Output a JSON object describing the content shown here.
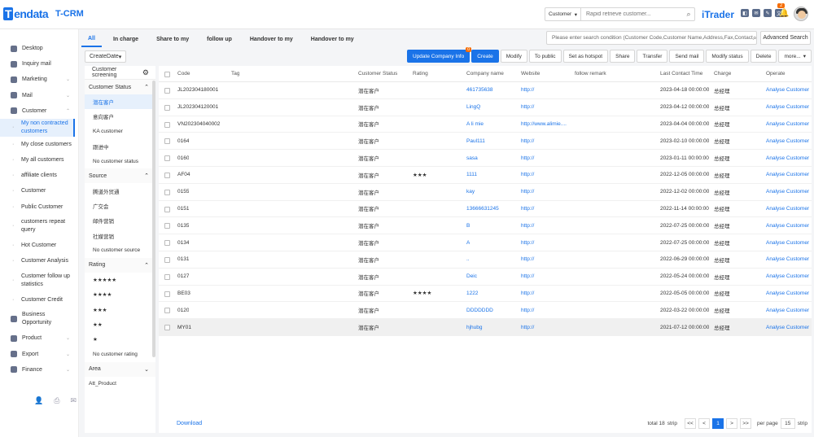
{
  "brand": {
    "logo": "Tendata",
    "logo_initial": "T",
    "product": "T-CRM",
    "itrader": "iTrader"
  },
  "topbar": {
    "search_select": "Customer",
    "search_placeholder": "Rapid retrieve customer...",
    "bell_badge": "2",
    "icons": [
      "app-icon",
      "mail-icon",
      "edit-icon",
      "translate-icon"
    ]
  },
  "sidebar": {
    "items": [
      {
        "label": "Desktop",
        "icon": "desktop-icon"
      },
      {
        "label": "Inquiry mail",
        "icon": "inquiry-icon"
      },
      {
        "label": "Marketing",
        "icon": "marketing-icon",
        "arrow": "⌄"
      },
      {
        "label": "Mail",
        "icon": "mail-icon",
        "arrow": "⌄"
      },
      {
        "label": "Customer",
        "icon": "customer-icon",
        "arrow": "⌃"
      }
    ],
    "sub_items": [
      {
        "label": "My non contracted customers",
        "active": true
      },
      {
        "label": "My close customers"
      },
      {
        "label": "My all customers"
      },
      {
        "label": "affiliate clients"
      },
      {
        "label": "Customer"
      },
      {
        "label": "Public Customer"
      },
      {
        "label": "customers repeat query"
      },
      {
        "label": "Hot Customer"
      },
      {
        "label": "Customer Analysis"
      },
      {
        "label": "Customer follow up statistics"
      },
      {
        "label": "Customer Credit"
      }
    ],
    "bottom_items": [
      {
        "label": "Business Opportunity",
        "icon": "business-icon"
      },
      {
        "label": "Product",
        "icon": "product-icon",
        "arrow": "⌄"
      },
      {
        "label": "Export",
        "icon": "export-icon",
        "arrow": "⌄"
      },
      {
        "label": "Finance",
        "icon": "finance-icon",
        "arrow": "⌄"
      }
    ]
  },
  "tabs": [
    "All",
    "In charge",
    "Share to my",
    "follow up",
    "Handover to my",
    "Handover to my"
  ],
  "condition_search_placeholder": "Please enter search condition (Customer Code,Customer Name,Address,Fax,Contact",
  "advanced_search": "Advanced Search",
  "sort_select": "CreateDate",
  "toolbar": {
    "update_label": "Update Company Info",
    "update_badge": "0",
    "buttons": [
      "Create",
      "Modify",
      "To public",
      "Set as hotspot",
      "Share",
      "Transfer",
      "Send mail",
      "Modify status",
      "Delete",
      "more..."
    ]
  },
  "filter": {
    "title": "Customer screening",
    "sections": [
      {
        "title": "Customer Status",
        "arrow": "⌃",
        "options": [
          "潜在客户",
          "意向客户",
          "KA customer",
          "跟进中",
          "No customer status"
        ],
        "active_index": 0
      },
      {
        "title": "Source",
        "arrow": "⌃",
        "options": [
          "腾道外贸通",
          "广交会",
          "邮件营销",
          "社媒营销",
          "No customer source"
        ]
      },
      {
        "title": "Rating",
        "arrow": "⌃",
        "options": [
          "★★★★★",
          "★★★★",
          "★★★",
          "★★",
          "★",
          "No customer rating"
        ]
      },
      {
        "title": "Area",
        "arrow": "⌄",
        "options": [
          "Att_Product"
        ]
      }
    ]
  },
  "table": {
    "headers": [
      "Code",
      "Tag",
      "Customer Status",
      "Rating",
      "Company name",
      "Website",
      "follow remark",
      "Last Contact Time",
      "Charge",
      "Operate"
    ],
    "rows": [
      {
        "code": "JL202304180001",
        "status": "潜在客户",
        "rating": "",
        "company": "461735638",
        "website": "http://",
        "last": "2023-04-18 00:00:00",
        "charge": "总经理",
        "op": "Analyse Customer"
      },
      {
        "code": "JL202304120001",
        "status": "潜在客户",
        "rating": "",
        "company": "LingQ",
        "website": "http://",
        "last": "2023-04-12 00:00:00",
        "charge": "总经理",
        "op": "Analyse Customer"
      },
      {
        "code": "VN202304040002",
        "status": "潜在客户",
        "rating": "",
        "company": "A li mie",
        "website": "http://www.alimie....",
        "last": "2023-04-04 00:00:00",
        "charge": "总经理",
        "op": "Analyse Customer"
      },
      {
        "code": "0164",
        "status": "潜在客户",
        "rating": "",
        "company": "Paul111",
        "website": "http://",
        "last": "2023-02-10 00:00:00",
        "charge": "总经理",
        "op": "Analyse Customer"
      },
      {
        "code": "0160",
        "status": "潜在客户",
        "rating": "",
        "company": "sasa",
        "website": "http://",
        "last": "2023-01-11 00:00:00",
        "charge": "总经理",
        "op": "Analyse Customer"
      },
      {
        "code": "AF04",
        "status": "潜在客户",
        "rating": "★★★",
        "company": "1111",
        "website": "http://",
        "last": "2022-12-05 00:00:00",
        "charge": "总经理",
        "op": "Analyse Customer"
      },
      {
        "code": "0155",
        "status": "潜在客户",
        "rating": "",
        "company": "kay",
        "website": "http://",
        "last": "2022-12-02 00:00:00",
        "charge": "总经理",
        "op": "Analyse Customer"
      },
      {
        "code": "0151",
        "status": "潜在客户",
        "rating": "",
        "company": "13666631245",
        "website": "http://",
        "last": "2022-11-14 00:00:00",
        "charge": "总经理",
        "op": "Analyse Customer"
      },
      {
        "code": "0135",
        "status": "潜在客户",
        "rating": "",
        "company": "B",
        "website": "http://",
        "last": "2022-07-25 00:00:00",
        "charge": "总经理",
        "op": "Analyse Customer"
      },
      {
        "code": "0134",
        "status": "潜在客户",
        "rating": "",
        "company": "A",
        "website": "http://",
        "last": "2022-07-25 00:00:00",
        "charge": "总经理",
        "op": "Analyse Customer"
      },
      {
        "code": "0131",
        "status": "潜在客户",
        "rating": "",
        "company": "..",
        "website": "http://",
        "last": "2022-06-29 00:00:00",
        "charge": "总经理",
        "op": "Analyse Customer"
      },
      {
        "code": "0127",
        "status": "潜在客户",
        "rating": "",
        "company": "Deic",
        "website": "http://",
        "last": "2022-05-24 00:00:00",
        "charge": "总经理",
        "op": "Analyse Customer"
      },
      {
        "code": "BE03",
        "status": "潜在客户",
        "rating": "★★★★",
        "company": "1222",
        "website": "http://",
        "last": "2022-05-05 00:00:00",
        "charge": "总经理",
        "op": "Analyse Customer"
      },
      {
        "code": "0120",
        "status": "潜在客户",
        "rating": "",
        "company": "DDDDDDD",
        "website": "http://",
        "last": "2022-03-22 00:00:00",
        "charge": "总经理",
        "op": "Analyse Customer"
      },
      {
        "code": "MY01",
        "status": "潜在客户",
        "rating": "",
        "company": "hjhubg",
        "website": "http://",
        "last": "2021-07-12 00:00:00",
        "charge": "总经理",
        "op": "Analyse Customer"
      }
    ]
  },
  "footer": {
    "download": "Download",
    "total": "total 18",
    "strip": "strip",
    "first": "<<",
    "prev": "<",
    "page": "1",
    "next": ">",
    "last": ">>",
    "per_page": "per page",
    "per_page_value": "15",
    "per_page_unit": "strip"
  }
}
